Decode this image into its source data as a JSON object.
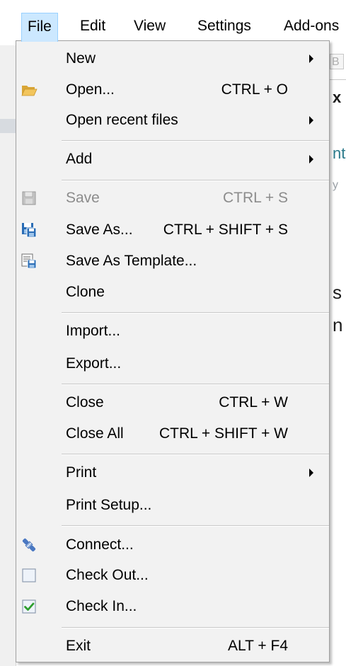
{
  "menubar": {
    "items": [
      {
        "label": "File"
      },
      {
        "label": "Edit"
      },
      {
        "label": "View"
      },
      {
        "label": "Settings"
      },
      {
        "label": "Add-ons"
      }
    ]
  },
  "background": {
    "box_text": "B",
    "fragments": [
      "x",
      "nt",
      "y",
      "s",
      "n"
    ]
  },
  "file_menu": {
    "items": [
      {
        "label": "New",
        "shortcut": "",
        "submenu": true,
        "icon": "",
        "enabled": true
      },
      {
        "label": "Open...",
        "shortcut": "CTRL + O",
        "submenu": false,
        "icon": "folder-open-icon",
        "enabled": true
      },
      {
        "label": "Open recent files",
        "shortcut": "",
        "submenu": true,
        "icon": "",
        "enabled": true
      },
      {
        "label": "Add",
        "shortcut": "",
        "submenu": true,
        "icon": "",
        "enabled": true
      },
      {
        "label": "Save",
        "shortcut": "CTRL + S",
        "submenu": false,
        "icon": "floppy-disk-icon",
        "enabled": false
      },
      {
        "label": "Save As...",
        "shortcut": "CTRL + SHIFT + S",
        "submenu": false,
        "icon": "save-as-icon",
        "enabled": true
      },
      {
        "label": "Save As Template...",
        "shortcut": "",
        "submenu": false,
        "icon": "save-as-template-icon",
        "enabled": true
      },
      {
        "label": "Clone",
        "shortcut": "",
        "submenu": false,
        "icon": "",
        "enabled": true
      },
      {
        "label": "Import...",
        "shortcut": "",
        "submenu": false,
        "icon": "",
        "enabled": true
      },
      {
        "label": "Export...",
        "shortcut": "",
        "submenu": false,
        "icon": "",
        "enabled": true
      },
      {
        "label": "Close",
        "shortcut": "CTRL + W",
        "submenu": false,
        "icon": "",
        "enabled": true
      },
      {
        "label": "Close All",
        "shortcut": "CTRL + SHIFT + W",
        "submenu": false,
        "icon": "",
        "enabled": true
      },
      {
        "label": "Print",
        "shortcut": "",
        "submenu": true,
        "icon": "",
        "enabled": true
      },
      {
        "label": "Print Setup...",
        "shortcut": "",
        "submenu": false,
        "icon": "",
        "enabled": true
      },
      {
        "label": "Connect...",
        "shortcut": "",
        "submenu": false,
        "icon": "connect-plug-icon",
        "enabled": true
      },
      {
        "label": "Check Out...",
        "shortcut": "",
        "submenu": false,
        "icon": "checkbox-unchecked-icon",
        "enabled": true
      },
      {
        "label": "Check In...",
        "shortcut": "",
        "submenu": false,
        "icon": "checkbox-checked-icon",
        "enabled": true
      },
      {
        "label": "Exit",
        "shortcut": "ALT + F4",
        "submenu": false,
        "icon": "",
        "enabled": true
      }
    ]
  },
  "colors": {
    "menu_background": "#f2f2f2",
    "active_menubar_item": "#cce8ff",
    "disabled_text": "#8c8c8c",
    "check_green": "#2e9e2e",
    "folder_yellow": "#e8b948",
    "floppy_blue": "#2a6cb5"
  }
}
